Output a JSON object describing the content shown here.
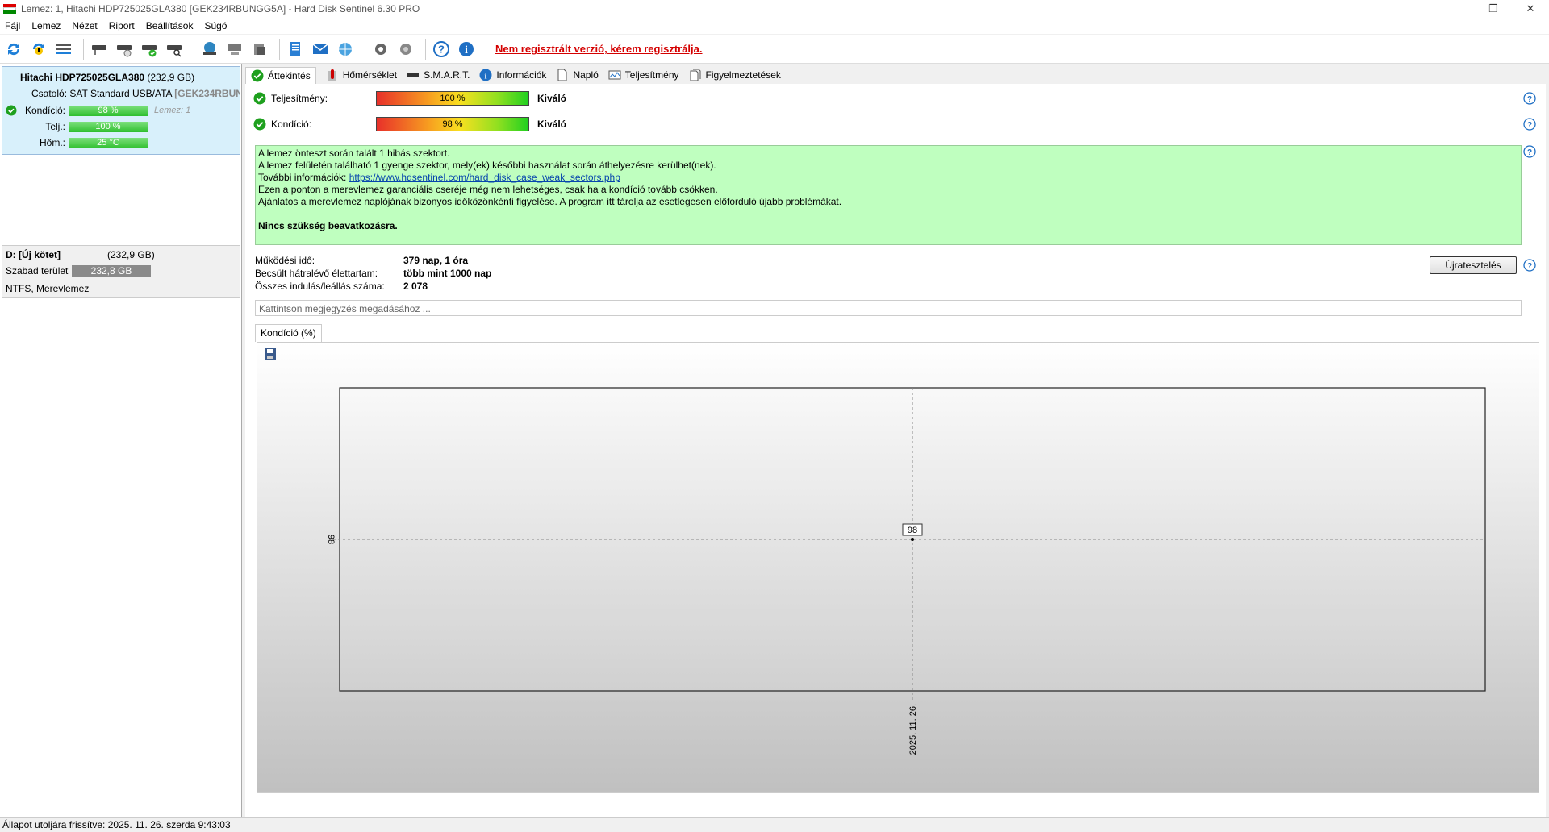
{
  "window": {
    "title": "Lemez: 1, Hitachi HDP725025GLA380 [GEK234RBUNGG5A]  -  Hard Disk Sentinel 6.30 PRO"
  },
  "menu": [
    {
      "label": "Fájl"
    },
    {
      "label": "Lemez"
    },
    {
      "label": "Nézet"
    },
    {
      "label": "Riport"
    },
    {
      "label": "Beállítások"
    },
    {
      "label": "Súgó"
    }
  ],
  "toolbar": {
    "register_text": "Nem regisztrált verzió, kérem regisztrálja."
  },
  "disk": {
    "name": "Hitachi HDP725025GLA380",
    "size": "(232,9 GB)",
    "connection_label": "Csatoló:",
    "connection_value": "SAT Standard USB/ATA",
    "serial": "[GEK234RBUNGG5A]",
    "health_label": "Kondíció:",
    "health_value": "98 %",
    "health_pct": 98,
    "disk_note": "Lemez: 1",
    "perf_label": "Telj.:",
    "perf_value": "100 %",
    "perf_pct": 100,
    "temp_label": "Hőm.:",
    "temp_value": "25 °C"
  },
  "volume": {
    "name": "D: [Új kötet]",
    "size": "(232,9 GB)",
    "free_label": "Szabad terület",
    "free_value": "232,8 GB",
    "fs": "NTFS, Merevlemez"
  },
  "tabs": [
    {
      "label": "Áttekintés"
    },
    {
      "label": "Hőmérséklet"
    },
    {
      "label": "S.M.A.R.T."
    },
    {
      "label": "Információk"
    },
    {
      "label": "Napló"
    },
    {
      "label": "Teljesítmény"
    },
    {
      "label": "Figyelmeztetések"
    }
  ],
  "overview": {
    "performance_label": "Teljesítmény:",
    "performance_value": "100 %",
    "performance_rating": "Kiváló",
    "health_label": "Kondíció:",
    "health_value": "98 %",
    "health_rating": "Kiváló",
    "message_lines": [
      "A lemez önteszt során talált 1 hibás szektort.",
      "A lemez felületén található 1 gyenge szektor, mely(ek) későbbi használat során áthelyezésre kerülhet(nek).",
      "További információk: ",
      "Ezen a ponton a merevlemez garanciális cseréje még nem lehetséges, csak ha a kondíció tovább csökken.",
      "Ajánlatos a merevlemez naplójának bizonyos időközönkénti figyelése. A program itt tárolja az esetlegesen előforduló újabb problémákat."
    ],
    "message_link": "https://www.hdsentinel.com/hard_disk_case_weak_sectors.php",
    "message_conclusion": "Nincs szükség beavatkozásra.",
    "uptime_label": "Működési idő:",
    "uptime_value": "379 nap, 1 óra",
    "remaining_label": "Becsült hátralévő élettartam:",
    "remaining_value": "több mint 1000 nap",
    "starts_label": "Összes indulás/leállás száma:",
    "starts_value": "2 078",
    "retest_button": "Újratesztelés",
    "note_placeholder": "Kattintson megjegyzés megadásához ..."
  },
  "chart_tab": "Kondíció  (%)",
  "chart_data": {
    "type": "line",
    "x": [
      "2025. 11. 26."
    ],
    "series": [
      {
        "values": [
          98
        ]
      }
    ],
    "data_labels": [
      "98"
    ],
    "ytick_labels": [
      "98"
    ],
    "xtick_labels": [
      "2025. 11. 26."
    ],
    "grid": true
  },
  "status": {
    "text": "Állapot utoljára frissítve: 2025. 11. 26. szerda 9:43:03"
  },
  "colors": {
    "register_text": "#d40000",
    "message_bg": "#bfffbf",
    "left_selected_bg": "#d8f0fb",
    "gauge_green": "#2fbf2f"
  }
}
